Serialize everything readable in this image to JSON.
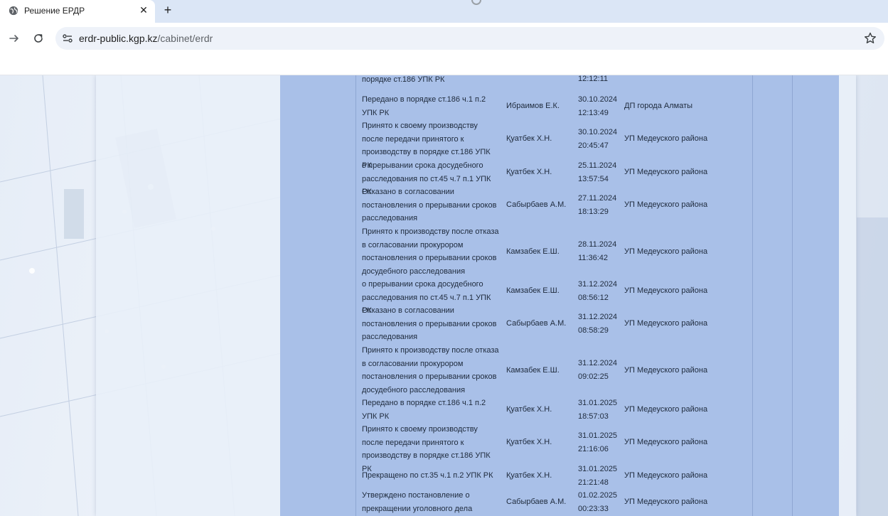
{
  "browser": {
    "tab_title": "Решение ЕРДР",
    "close_glyph": "✕",
    "new_tab_glyph": "+",
    "url_host": "erdr-public.kgp.kz",
    "url_path": "/cabinet/erdr",
    "icons": [
      "globe-icon",
      "close-icon",
      "plus-icon",
      "forward-icon",
      "reload-icon",
      "site-info-icon",
      "star-icon"
    ]
  },
  "table": {
    "rows": [
      {
        "description": "порядке ст.186 УПК РК",
        "name": "",
        "date": "12:12:11",
        "organ": ""
      },
      {
        "description": "Передано в порядке ст.186 ч.1 п.2 УПК РК",
        "name": "Ибраимов Е.К.",
        "date": "30.10.2024 12:13:49",
        "organ": "ДП города Алматы"
      },
      {
        "description": "Принято к своему производству после передачи принятого к производству в порядке ст.186 УПК РК",
        "name": "Қуатбек Х.Н.",
        "date": "30.10.2024 20:45:47",
        "organ": "УП Медеуского района"
      },
      {
        "description": "о прерывании срока досудебного расследования по ст.45 ч.7 п.1 УПК РК",
        "name": "Қуатбек Х.Н.",
        "date": "25.11.2024 13:57:54",
        "organ": "УП Медеуского района"
      },
      {
        "description": "Отказано в согласовании постановления о прерывании сроков расследования",
        "name": "Сабырбаев А.М.",
        "date": "27.11.2024 18:13:29",
        "organ": "УП Медеуского района"
      },
      {
        "description": "Принято к производству после отказа в согласовании прокурором постановления о прерывании сроков досудебного расследования",
        "name": "Камзабек Е.Ш.",
        "date": "28.11.2024 11:36:42",
        "organ": "УП Медеуского района"
      },
      {
        "description": "о прерывании срока досудебного расследования по ст.45 ч.7 п.1 УПК РК",
        "name": "Камзабек Е.Ш.",
        "date": "31.12.2024 08:56:12",
        "organ": "УП Медеуского района"
      },
      {
        "description": "Отказано в согласовании постановления о прерывании сроков расследования",
        "name": "Сабырбаев А.М.",
        "date": "31.12.2024 08:58:29",
        "organ": "УП Медеуского района"
      },
      {
        "description": "Принято к производству после отказа в согласовании прокурором постановления о прерывании сроков досудебного расследования",
        "name": "Камзабек Е.Ш.",
        "date": "31.12.2024 09:02:25",
        "organ": "УП Медеуского района"
      },
      {
        "description": "Передано в порядке ст.186 ч.1 п.2 УПК РК",
        "name": "Қуатбек Х.Н.",
        "date": "31.01.2025 18:57:03",
        "organ": "УП Медеуского района"
      },
      {
        "description": "Принято к своему производству после передачи принятого к производству в порядке ст.186 УПК РК",
        "name": "Қуатбек Х.Н.",
        "date": "31.01.2025 21:16:06",
        "organ": "УП Медеуского района"
      },
      {
        "description": "Прекращено по ст.35 ч.1 п.2 УПК РК",
        "name": "Қуатбек Х.Н.",
        "date": "31.01.2025 21:21:48",
        "organ": "УП Медеуского района"
      },
      {
        "description": "Утверждено постановление о прекращении уголовного дела",
        "name": "Сабырбаев А.М.",
        "date": "01.02.2025 00:23:33",
        "organ": "УП Медеуского района"
      }
    ]
  },
  "colors": {
    "table_bg": "#a9c0e8",
    "chrome_bg": "#dbe6f6",
    "omnibox_bg": "#eef2f9"
  }
}
